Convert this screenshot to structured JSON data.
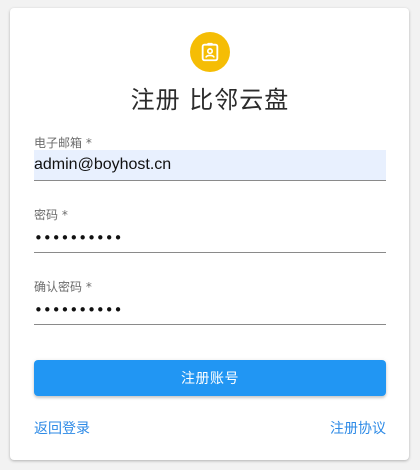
{
  "header": {
    "icon": "badge-icon",
    "icon_color": "#f5bd05",
    "title": "注册 比邻云盘"
  },
  "form": {
    "email": {
      "label": "电子邮箱 *",
      "value": "admin@boyhost.cn"
    },
    "password": {
      "label": "密码 *",
      "masked_value": "••••••••••"
    },
    "confirm_password": {
      "label": "确认密码 *",
      "masked_value": "••••••••••"
    },
    "submit_label": "注册账号",
    "accent_color": "#2196f3"
  },
  "footer": {
    "back_to_login": "返回登录",
    "terms": "注册协议",
    "link_color": "#2d8ae6"
  }
}
